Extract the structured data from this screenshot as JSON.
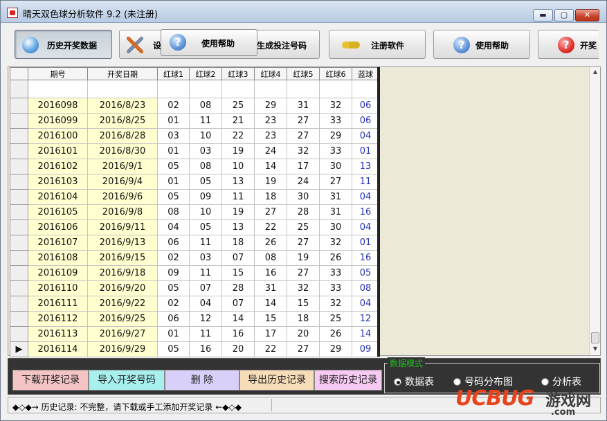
{
  "window": {
    "title": "晴天双色球分析软件 9.2  (未注册)",
    "controls": {
      "minimize": "▬",
      "maximize": "▢",
      "close": "✕"
    }
  },
  "toolbar": {
    "buttons": [
      {
        "label": "历史开奖数据",
        "icon": "globe-icon",
        "pressed": true
      },
      {
        "label": "设",
        "icon": "tools-icon"
      },
      {
        "label": "生成投注号码",
        "icon": ""
      },
      {
        "label": "注册软件",
        "icon": "key-icon"
      },
      {
        "label": "使用帮助",
        "icon": "help-icon"
      },
      {
        "label": "开奖",
        "icon": "red-question-icon"
      }
    ],
    "hover_button": {
      "label": "使用帮助",
      "icon": "help-icon",
      "icon_glyph": "?"
    }
  },
  "grid": {
    "columns": [
      "期号",
      "开奖日期",
      "红球1",
      "红球2",
      "红球3",
      "红球4",
      "红球5",
      "红球6",
      "蓝球"
    ],
    "rows": [
      [
        "2016098",
        "2016/8/23",
        "02",
        "08",
        "25",
        "29",
        "31",
        "32",
        "06"
      ],
      [
        "2016099",
        "2016/8/25",
        "01",
        "11",
        "21",
        "23",
        "27",
        "33",
        "06"
      ],
      [
        "2016100",
        "2016/8/28",
        "03",
        "10",
        "22",
        "23",
        "27",
        "29",
        "04"
      ],
      [
        "2016101",
        "2016/8/30",
        "01",
        "03",
        "19",
        "24",
        "32",
        "33",
        "01"
      ],
      [
        "2016102",
        "2016/9/1",
        "05",
        "08",
        "10",
        "14",
        "17",
        "30",
        "13"
      ],
      [
        "2016103",
        "2016/9/4",
        "01",
        "05",
        "13",
        "19",
        "24",
        "27",
        "11"
      ],
      [
        "2016104",
        "2016/9/6",
        "05",
        "09",
        "11",
        "18",
        "30",
        "31",
        "04"
      ],
      [
        "2016105",
        "2016/9/8",
        "08",
        "10",
        "19",
        "27",
        "28",
        "31",
        "16"
      ],
      [
        "2016106",
        "2016/9/11",
        "04",
        "05",
        "13",
        "22",
        "25",
        "30",
        "04"
      ],
      [
        "2016107",
        "2016/9/13",
        "06",
        "11",
        "18",
        "26",
        "27",
        "32",
        "01"
      ],
      [
        "2016108",
        "2016/9/15",
        "02",
        "03",
        "07",
        "08",
        "19",
        "26",
        "16"
      ],
      [
        "2016109",
        "2016/9/18",
        "09",
        "11",
        "15",
        "16",
        "27",
        "33",
        "05"
      ],
      [
        "2016110",
        "2016/9/20",
        "05",
        "07",
        "28",
        "31",
        "32",
        "33",
        "08"
      ],
      [
        "2016111",
        "2016/9/22",
        "02",
        "04",
        "07",
        "14",
        "15",
        "32",
        "04"
      ],
      [
        "2016112",
        "2016/9/25",
        "06",
        "12",
        "14",
        "15",
        "18",
        "25",
        "12"
      ],
      [
        "2016113",
        "2016/9/27",
        "01",
        "11",
        "16",
        "17",
        "20",
        "26",
        "14"
      ],
      [
        "2016114",
        "2016/9/29",
        "05",
        "16",
        "20",
        "22",
        "27",
        "29",
        "09"
      ]
    ],
    "current_row_indicator": "▶"
  },
  "actions": [
    {
      "label": "下载开奖记录",
      "color": "#f4c4c4"
    },
    {
      "label": "导入开奖号码",
      "color": "#a8f0ee"
    },
    {
      "label": "删  除",
      "color": "#d8d0f8"
    },
    {
      "label": "导出历史记录",
      "color": "#f7dcb8"
    },
    {
      "label": "搜索历史记录",
      "color": "#f6caf2"
    }
  ],
  "data_mode": {
    "legend": "数据模式",
    "options": [
      {
        "label": "数据表",
        "selected": true
      },
      {
        "label": "号码分布图",
        "selected": false
      },
      {
        "label": "分析表",
        "selected": false
      }
    ]
  },
  "status": {
    "text": "◆◇◆→  历史记录: 不完整，请下载或手工添加开奖记录  ←◆◇◆"
  },
  "watermark": {
    "logo": "UCBUG",
    "cn": "游戏网",
    "com": ".com"
  }
}
